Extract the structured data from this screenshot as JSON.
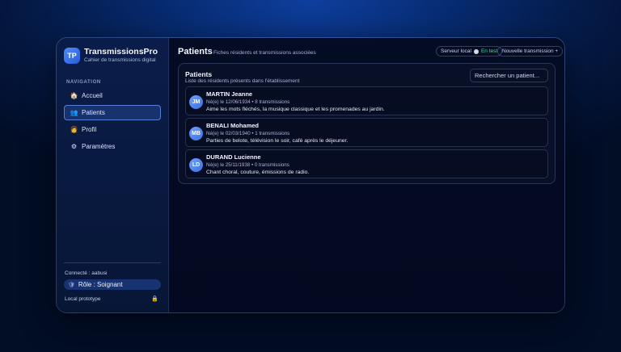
{
  "app": {
    "logo_text": "TP",
    "name": "TransmissionsPro",
    "subtitle": "Cahier de transmissions digital"
  },
  "sidebar": {
    "nav_label": "NAVIGATION",
    "items": [
      {
        "label": "Accueil",
        "icon": "home-icon",
        "glyph": "🏠",
        "active": false
      },
      {
        "label": "Patients",
        "icon": "patients-icon",
        "glyph": "👥",
        "active": true
      },
      {
        "label": "Profil",
        "icon": "profile-icon",
        "glyph": "👩",
        "active": false
      },
      {
        "label": "Paramètres",
        "icon": "gear-icon",
        "glyph": "⚙",
        "active": false
      }
    ],
    "connected": "Connecté : aabusi",
    "role": "Rôle : Soignant",
    "local": "Local prototype"
  },
  "header": {
    "title": "Patients",
    "subtitle": "Fiches résidents et transmissions associées",
    "server_label": "Serveur local",
    "server_status": "En test",
    "new_transmission": "Nouvelle transmission +"
  },
  "panel": {
    "title": "Patients",
    "subtitle": "Liste des résidents présents dans l'établissement",
    "search_placeholder": "Rechercher un patient..."
  },
  "patients": [
    {
      "initials": "JM",
      "name": "MARTIN Jeanne",
      "meta": "Né(e) le 12/06/1934 • 8 transmissions",
      "desc": "Aime les mots fléchés, la musique classique et les promenades au jardin."
    },
    {
      "initials": "MB",
      "name": "BENALI Mohamed",
      "meta": "Né(e) le 02/03/1940 • 1 transmissions",
      "desc": "Parties de belote, télévision le soir, café après le déjeuner."
    },
    {
      "initials": "LD",
      "name": "DURAND Lucienne",
      "meta": "Né(e) le 25/11/1938 • 0 transmissions",
      "desc": "Chant choral, couture, émissions de radio."
    }
  ],
  "colors": {
    "accent": "#4f8cf7",
    "status_ok": "#4fd69a",
    "background": "#04173f"
  }
}
